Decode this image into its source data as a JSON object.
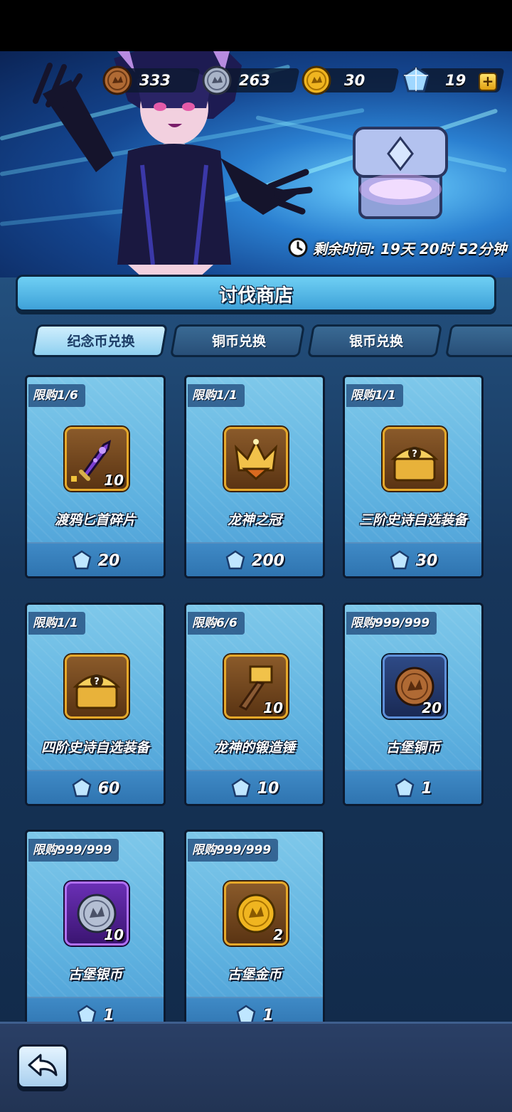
{
  "currencies": [
    {
      "name": "bronze-coin",
      "value": "333",
      "color": "#b06a34"
    },
    {
      "name": "silver-coin",
      "value": "263",
      "color": "#a9b4c8"
    },
    {
      "name": "gold-coin",
      "value": "30",
      "color": "#f0b520"
    },
    {
      "name": "crystal",
      "value": "19",
      "color": "#9fd7ff"
    }
  ],
  "plus_label": "+",
  "timer": {
    "label": "剩余时间: 19天 20时 52分钟"
  },
  "shop": {
    "title": "讨伐商店"
  },
  "tabs": [
    {
      "label": "纪念币兑换",
      "active": true
    },
    {
      "label": "铜币兑换",
      "active": false
    },
    {
      "label": "银币兑换",
      "active": false
    },
    {
      "label": "",
      "active": false
    }
  ],
  "items": [
    {
      "limit": "限购1/6",
      "name": "渡鸦匕首碎片",
      "qty": "10",
      "price": "20",
      "icon": "dagger-fragment-icon"
    },
    {
      "limit": "限购1/1",
      "name": "龙神之冠",
      "qty": "",
      "price": "200",
      "icon": "crown-icon"
    },
    {
      "limit": "限购1/1",
      "name": "三阶史诗自选装备",
      "qty": "",
      "price": "30",
      "icon": "treasure-chest-icon"
    },
    {
      "limit": "限购1/1",
      "name": "四阶史诗自选装备",
      "qty": "",
      "price": "60",
      "icon": "treasure-chest-icon"
    },
    {
      "limit": "限购6/6",
      "name": "龙神的锻造锤",
      "qty": "10",
      "price": "10",
      "icon": "hammer-icon"
    },
    {
      "limit": "限购999/999",
      "name": "古堡铜币",
      "qty": "20",
      "price": "1",
      "icon": "bronze-coin-icon"
    },
    {
      "limit": "限购999/999",
      "name": "古堡银币",
      "qty": "10",
      "price": "1",
      "icon": "silver-coin-icon"
    },
    {
      "limit": "限购999/999",
      "name": "古堡金币",
      "qty": "2",
      "price": "1",
      "icon": "gold-coin-icon"
    }
  ],
  "colors": {
    "accent": "#5fb2e0",
    "frame_gold": "#e6a829",
    "dark": "#0c1a30"
  }
}
